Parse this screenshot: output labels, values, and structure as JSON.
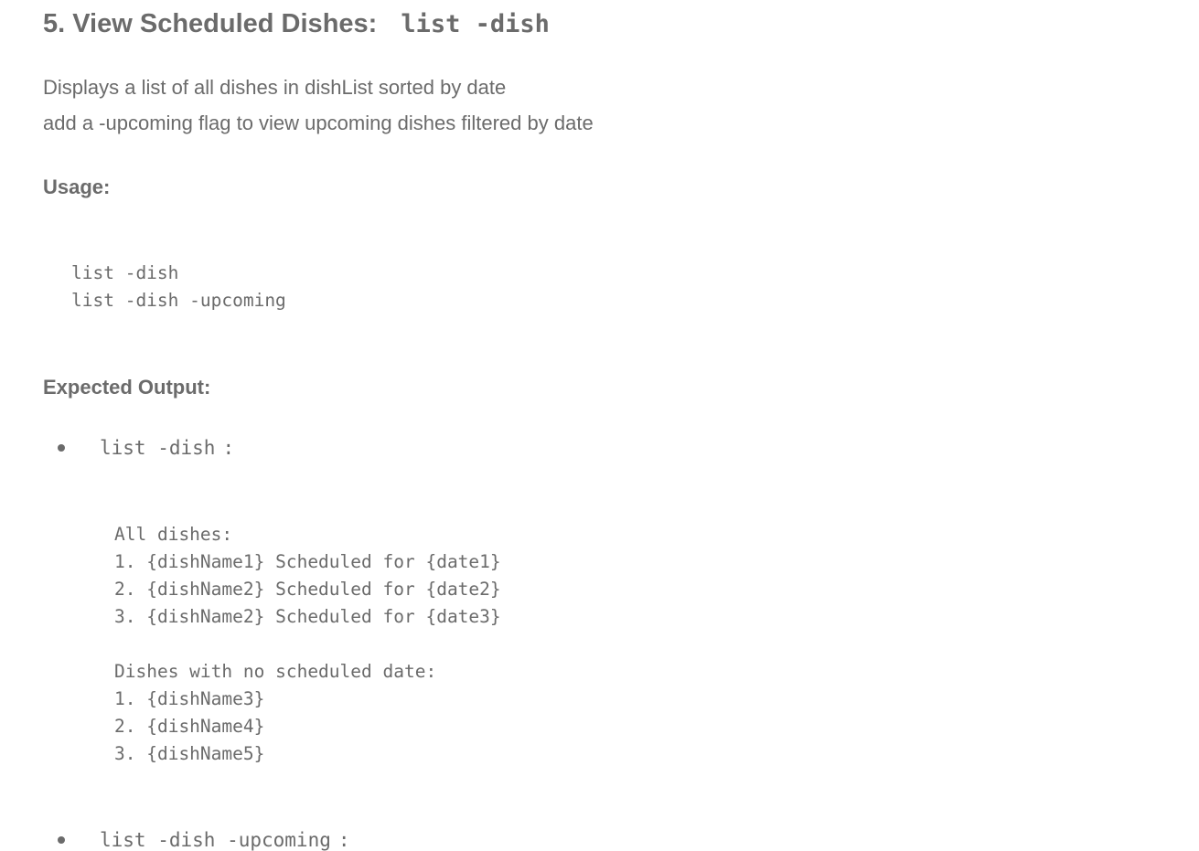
{
  "section": {
    "title": "5. View Scheduled Dishes:",
    "command": "list -dish"
  },
  "description": {
    "line1": "Displays a list of all dishes in dishList sorted by date",
    "line2": "add a -upcoming flag to view upcoming dishes filtered by date"
  },
  "usage": {
    "label": "Usage:",
    "lines": [
      "list -dish",
      "list -dish -upcoming"
    ]
  },
  "expected_output": {
    "label": "Expected Output:",
    "items": [
      {
        "command": "list -dish",
        "suffix": ":",
        "output": [
          "All dishes:",
          "1. {dishName1} Scheduled for {date1}",
          "2. {dishName2} Scheduled for {date2}",
          "3. {dishName2} Scheduled for {date3}",
          "",
          "Dishes with no scheduled date:",
          "1. {dishName3}",
          "2. {dishName4}",
          "3. {dishName5}"
        ]
      },
      {
        "command": "list -dish -upcoming",
        "suffix": ":"
      }
    ]
  }
}
